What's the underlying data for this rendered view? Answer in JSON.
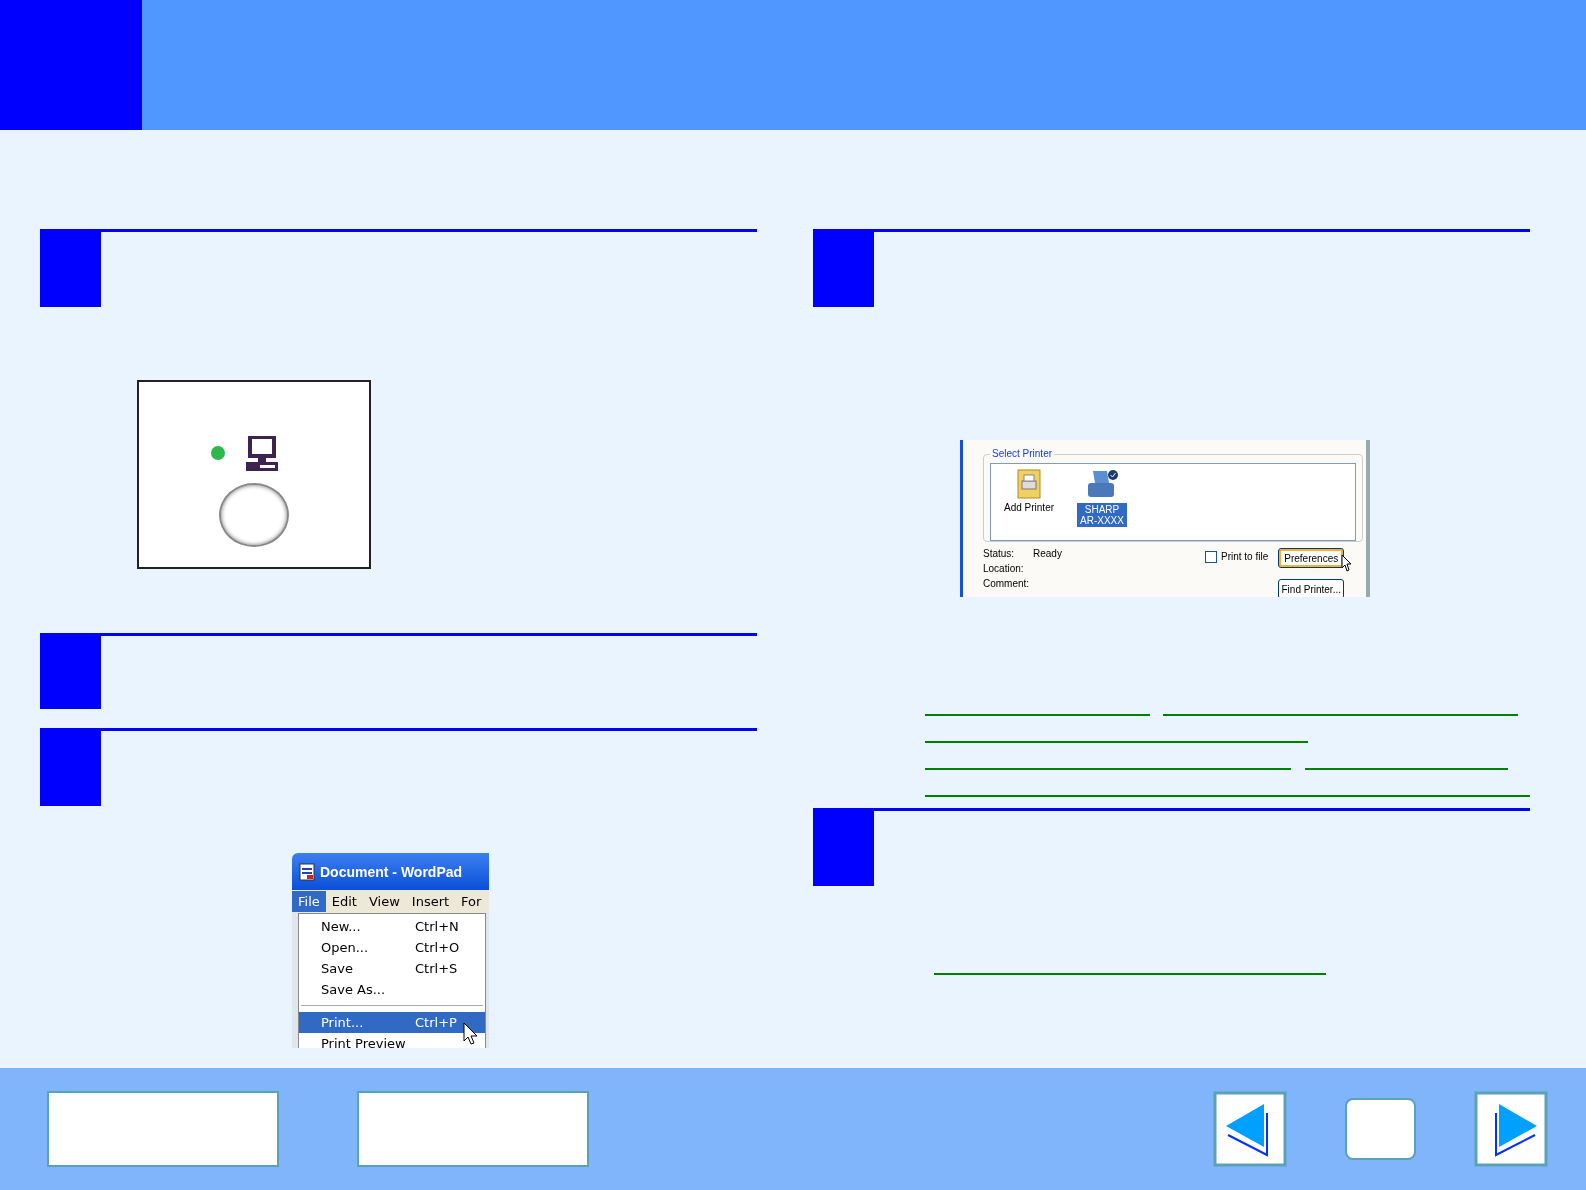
{
  "print_dialog": {
    "group_label": "Select Printer",
    "printers": [
      {
        "label": "Add Printer",
        "kind": "add",
        "selected": false
      },
      {
        "label": "SHARP\nAR-XXXX",
        "kind": "printer",
        "selected": true
      }
    ],
    "status_label": "Status:",
    "status_value": "Ready",
    "location_label": "Location:",
    "comment_label": "Comment:",
    "print_to_file": {
      "label": "Print to file",
      "checked": false
    },
    "buttons": [
      {
        "label": "Preferences",
        "focused": true
      },
      {
        "label": "Find Printer...",
        "focused": false
      }
    ]
  },
  "wordpad": {
    "title": "Document - WordPad",
    "menu": [
      {
        "label": "File",
        "selected": true
      },
      {
        "label": "Edit",
        "selected": false
      },
      {
        "label": "View",
        "selected": false
      },
      {
        "label": "Insert",
        "selected": false
      },
      {
        "label": "For",
        "selected": false
      }
    ],
    "items": [
      {
        "label": "New...",
        "shortcut": "Ctrl+N",
        "selected": false
      },
      {
        "label": "Open...",
        "shortcut": "Ctrl+O",
        "selected": false
      },
      {
        "label": "Save",
        "shortcut": "Ctrl+S",
        "selected": false
      },
      {
        "label": "Save As...",
        "selected": false
      },
      {
        "label": "Print...",
        "shortcut": "Ctrl+P",
        "selected": true,
        "separator_before": true
      },
      {
        "label": "Print Preview",
        "selected": false
      }
    ]
  }
}
